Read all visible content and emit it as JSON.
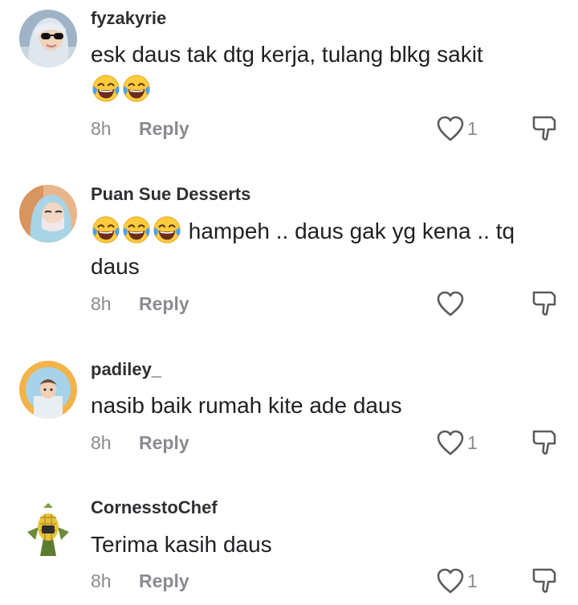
{
  "comments": [
    {
      "username": "fyzakyrie",
      "text": "esk daus tak dtg kerja, tulang blkg sakit",
      "emoji_count": 2,
      "time": "8h",
      "reply_label": "Reply",
      "like_count": "1"
    },
    {
      "username": "Puan Sue Desserts",
      "text": "hampeh .. daus gak yg kena .. tq daus",
      "emoji_count": 3,
      "time": "8h",
      "reply_label": "Reply",
      "like_count": ""
    },
    {
      "username": "padiley_",
      "text": "nasib baik rumah kite ade daus",
      "time": "8h",
      "reply_label": "Reply",
      "like_count": "1"
    },
    {
      "username": "CornesstoChef",
      "text": "Terima kasih daus",
      "time": "8h",
      "reply_label": "Reply",
      "like_count": "1"
    }
  ],
  "icons": {
    "like": "heart-outline-icon",
    "dislike": "thumbs-down-outline-icon",
    "emoji": "face-with-tears-of-joy-emoji"
  },
  "colors": {
    "username": "#2f2f33",
    "text": "#1f1f24",
    "meta": "#8a8b91",
    "icon": "#5b5c61"
  }
}
